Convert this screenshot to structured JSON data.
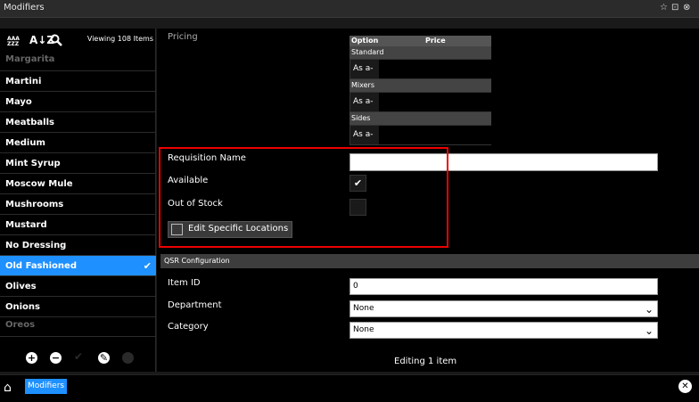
{
  "window": {
    "title": "Modifiers",
    "controls": [
      "☆",
      "⊡",
      "⊗"
    ]
  },
  "sidebar": {
    "toolbar": {
      "sort_alpha_label": "AAA\nZZZ",
      "sort_label": "A↓Z",
      "viewing_text": "Viewing 108 Items"
    },
    "items": [
      {
        "label": "Margarita",
        "state": "partial"
      },
      {
        "label": "Martini"
      },
      {
        "label": "Mayo"
      },
      {
        "label": "Meatballs"
      },
      {
        "label": "Medium"
      },
      {
        "label": "Mint Syrup"
      },
      {
        "label": "Moscow Mule"
      },
      {
        "label": "Mushrooms"
      },
      {
        "label": "Mustard"
      },
      {
        "label": "No Dressing"
      },
      {
        "label": "Old Fashioned",
        "selected": true
      },
      {
        "label": "Olives"
      },
      {
        "label": "Onions"
      },
      {
        "label": "Oreos",
        "state": "partial"
      }
    ]
  },
  "pricing": {
    "label": "Pricing",
    "headers": [
      "Option",
      "Price"
    ],
    "groups": [
      {
        "name": "Standard",
        "option": "As a-"
      },
      {
        "name": "Mixers",
        "option": "As a-"
      },
      {
        "name": "Sides",
        "option": "As a-"
      }
    ]
  },
  "form": {
    "requisition_label": "Requisition Name",
    "requisition_value": "",
    "available_label": "Available",
    "available_checked": "✔",
    "out_of_stock_label": "Out of Stock",
    "edit_locations_label": "Edit Specific Locations"
  },
  "qsr": {
    "header": "QSR Configuration",
    "item_id_label": "Item ID",
    "item_id_value": "0",
    "department_label": "Department",
    "department_value": "None",
    "category_label": "Category",
    "category_value": "None"
  },
  "status": "Editing 1 item",
  "bottombar": {
    "tab_label": "Modifiers"
  },
  "colors": {
    "accent": "#1e90ff",
    "highlight": "#e00000"
  }
}
